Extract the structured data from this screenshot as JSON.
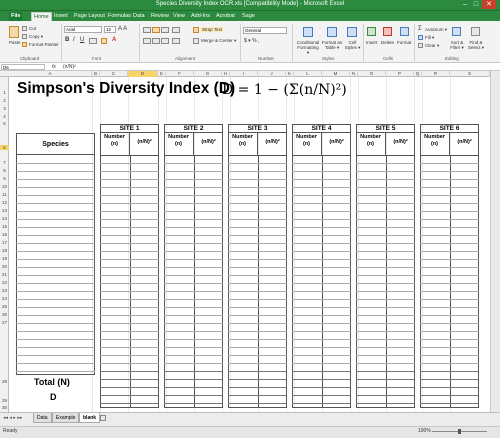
{
  "window": {
    "title": "Species Diversity Index OCR.xls  [Compatibility Mode] - Microsoft Excel",
    "controls": [
      "–",
      "□",
      "✕"
    ]
  },
  "tabs": [
    "File",
    "Home",
    "Insert",
    "Page Layout",
    "Formulas",
    "Data",
    "Review",
    "View",
    "Add-Ins",
    "Acrobat",
    "Sage"
  ],
  "ribbon": {
    "clipboard": {
      "paste": "Paste",
      "cut": "Cut",
      "copy": "Copy ▾",
      "format_painter": "Format Painter",
      "label": "Clipboard"
    },
    "font": {
      "name": "Arial",
      "size": "12",
      "label": "Font"
    },
    "alignment": {
      "wrap": "Wrap Text",
      "merge": "Merge & Center ▾",
      "label": "Alignment"
    },
    "number": {
      "format": "General",
      "currency": "$ ▾ % ,",
      "label": "Number"
    },
    "styles": {
      "conditional": "Conditional Formatting ▾",
      "format_table": "Format as Table ▾",
      "cell_styles": "Cell Styles ▾",
      "label": "Styles"
    },
    "cells": {
      "insert": "Insert",
      "delete": "Delete",
      "format": "Format",
      "label": "Cells"
    },
    "editing": {
      "autosum": "AutoSum ▾",
      "fill": "Fill ▾",
      "clear": "Clear ▾",
      "sort": "Sort & Filter ▾",
      "find": "Find & Select ▾",
      "label": "Editing"
    }
  },
  "formula_bar": {
    "cell_ref": "D6",
    "fx": "fx",
    "content": "(n/N)²"
  },
  "columns": [
    "A",
    "B",
    "C",
    "D",
    "E",
    "F",
    "G",
    "H",
    "I",
    "J",
    "K",
    "L",
    "M",
    "N",
    "O",
    "P",
    "Q",
    "R",
    "S"
  ],
  "rows": [
    "1",
    "2",
    "3",
    "4",
    "5",
    "6",
    "7",
    "8",
    "9",
    "10",
    "11",
    "12",
    "13",
    "14",
    "15",
    "16",
    "17",
    "18",
    "19",
    "20",
    "21",
    "22",
    "23",
    "24",
    "25",
    "26",
    "27",
    "28",
    "29",
    "30"
  ],
  "sheet": {
    "title": "Simpson's Diversity Index (D)",
    "formula": "D = 1 − (Σ(n/N)²)",
    "species_header": "Species",
    "total_label": "Total (N)",
    "d_label": "D",
    "sites": [
      "SITE 1",
      "SITE 2",
      "SITE 3",
      "SITE 4",
      "SITE 5",
      "SITE 6"
    ],
    "number_header": "Number (n)",
    "ratio_header": "(n/N)²"
  },
  "sheet_tabs": [
    "Data",
    "Example",
    "blank"
  ],
  "active_sheet": "blank",
  "status": {
    "ready": "Ready",
    "zoom": "100%"
  }
}
